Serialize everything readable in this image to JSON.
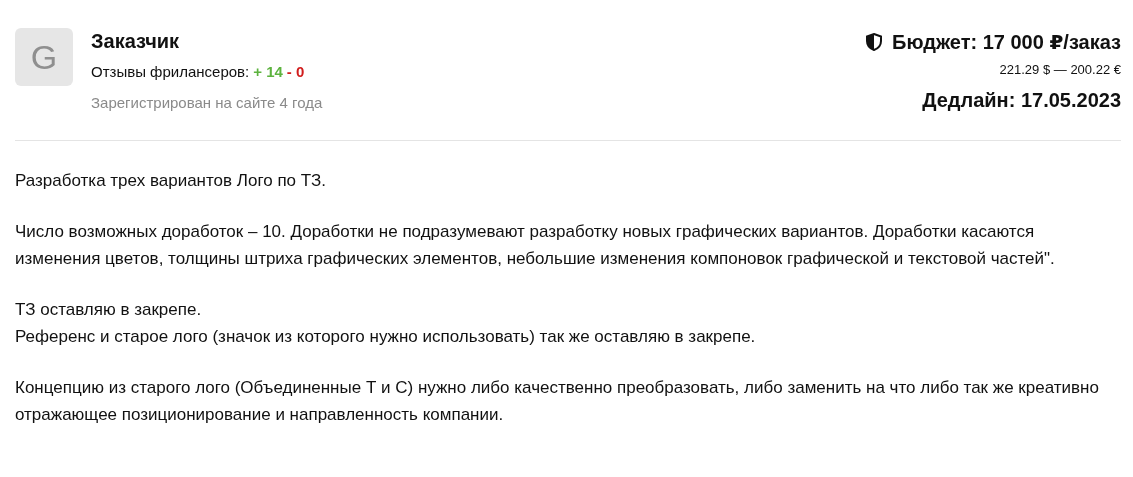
{
  "customer": {
    "avatar_letter": "G",
    "name": "Заказчик",
    "reviews_label": "Отзывы фрилансеров:",
    "reviews_positive": "+ 14",
    "reviews_negative": "- 0",
    "registered": "Зарегистрирован на сайте 4 года"
  },
  "budget": {
    "label": "Бюджет: 17 000 ₽/заказ",
    "conversion": "221.29 $ — 200.22 €",
    "deadline": "Дедлайн: 17.05.2023"
  },
  "description": [
    [
      "Разработка трех вариантов Лого по ТЗ."
    ],
    [
      "Число возможных доработок – 10. Доработки не подразумевают разработку новых графических вариантов. Доработки касаются изменения цветов, толщины штриха графических элементов, небольшие изменения компоновок графической и текстовой частей\"."
    ],
    [
      "ТЗ оставляю в закрепе.",
      "Референс и старое лого (значок из которого нужно использовать) так же оставляю в закрепе."
    ],
    [
      "Концепцию из старого лого (Объединенные Т и С) нужно либо качественно преобразовать, либо заменить на что либо так же креативно отражающее позиционирование и направленность компании."
    ]
  ]
}
